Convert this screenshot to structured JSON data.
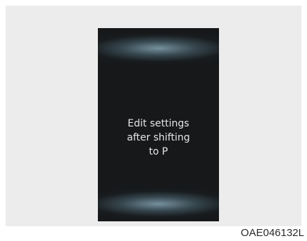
{
  "display": {
    "message_lines": [
      "Edit settings",
      "after shifting",
      "to P"
    ]
  },
  "caption": "OAE046132L"
}
